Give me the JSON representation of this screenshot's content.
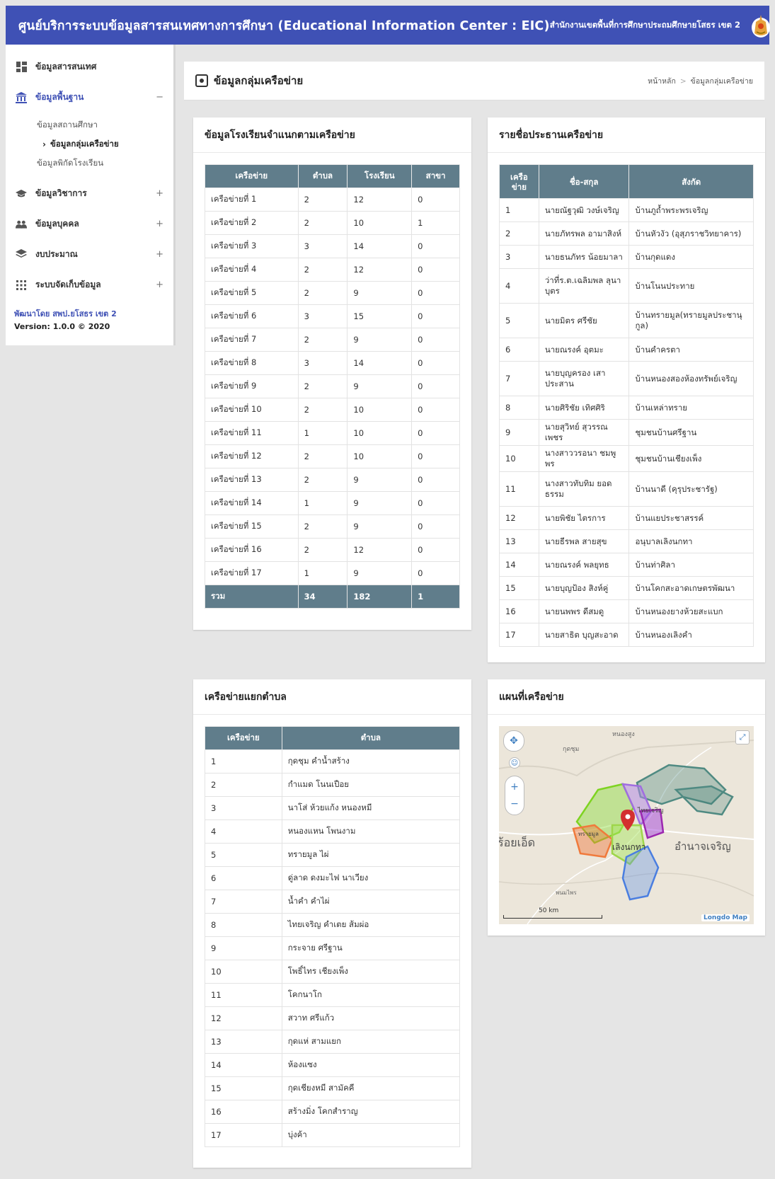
{
  "header": {
    "site_title": "ศูนย์บริการระบบข้อมูลสารสนเทศทางการศึกษา (Educational Information Center : EIC)",
    "office": "สำนักงานเขตพื้นที่การศึกษาประถมศึกษายโสธร เขต 2"
  },
  "sidebar": {
    "items": [
      {
        "label": "ข้อมูลสารสนเทศ",
        "icon": "dashboard-icon"
      },
      {
        "label": "ข้อมูลพื้นฐาน",
        "icon": "institution-icon",
        "toggle": "−"
      },
      {
        "label": "ข้อมูลวิชาการ",
        "icon": "graduation-cap-icon",
        "toggle": "+"
      },
      {
        "label": "ข้อมูลบุคคล",
        "icon": "people-icon",
        "toggle": "+"
      },
      {
        "label": "งบประมาณ",
        "icon": "layers-icon",
        "toggle": "+"
      },
      {
        "label": "ระบบจัดเก็บข้อมูล",
        "icon": "apps-grid-icon",
        "toggle": "+"
      }
    ],
    "submenu": [
      {
        "label": "ข้อมูลสถานศึกษา"
      },
      {
        "label": "ข้อมูลกลุ่มเครือข่าย"
      },
      {
        "label": "ข้อมูลพิกัดโรงเรียน"
      }
    ],
    "footer_dev": "พัฒนาโดย สพป.ยโสธร เขต 2",
    "footer_version": "Version: 1.0.0 © 2020"
  },
  "page": {
    "title": "ข้อมูลกลุ่มเครือข่าย",
    "breadcrumb_home": "หน้าหลัก",
    "breadcrumb_sep": ">",
    "breadcrumb_current": "ข้อมูลกลุ่มเครือข่าย"
  },
  "schools_card": {
    "title": "ข้อมูลโรงเรียนจำแนกตามเครือข่าย",
    "headers": [
      "เครือข่าย",
      "ตำบล",
      "โรงเรียน",
      "สาขา"
    ],
    "rows": [
      [
        "เครือข่ายที่ 1",
        "2",
        "12",
        "0"
      ],
      [
        "เครือข่ายที่ 2",
        "2",
        "10",
        "1"
      ],
      [
        "เครือข่ายที่ 3",
        "3",
        "14",
        "0"
      ],
      [
        "เครือข่ายที่ 4",
        "2",
        "12",
        "0"
      ],
      [
        "เครือข่ายที่ 5",
        "2",
        "9",
        "0"
      ],
      [
        "เครือข่ายที่ 6",
        "3",
        "15",
        "0"
      ],
      [
        "เครือข่ายที่ 7",
        "2",
        "9",
        "0"
      ],
      [
        "เครือข่ายที่ 8",
        "3",
        "14",
        "0"
      ],
      [
        "เครือข่ายที่ 9",
        "2",
        "9",
        "0"
      ],
      [
        "เครือข่ายที่ 10",
        "2",
        "10",
        "0"
      ],
      [
        "เครือข่ายที่ 11",
        "1",
        "10",
        "0"
      ],
      [
        "เครือข่ายที่ 12",
        "2",
        "10",
        "0"
      ],
      [
        "เครือข่ายที่ 13",
        "2",
        "9",
        "0"
      ],
      [
        "เครือข่ายที่ 14",
        "1",
        "9",
        "0"
      ],
      [
        "เครือข่ายที่ 15",
        "2",
        "9",
        "0"
      ],
      [
        "เครือข่ายที่ 16",
        "2",
        "12",
        "0"
      ],
      [
        "เครือข่ายที่ 17",
        "1",
        "9",
        "0"
      ]
    ],
    "total": [
      "รวม",
      "34",
      "182",
      "1"
    ]
  },
  "chairs_card": {
    "title": "รายชื่อประธานเครือข่าย",
    "headers": [
      "เครือ ข่าย",
      "ชื่อ-สกุล",
      "สังกัด"
    ],
    "rows": [
      [
        "1",
        "นายณัฐวุฒิ วงษ์เจริญ",
        "บ้านภูถ้ำพระพรเจริญ"
      ],
      [
        "2",
        "นายภัทรพล อามาสิงห์",
        "บ้านหัวงัว (อุสุภราชวิทยาคาร)"
      ],
      [
        "3",
        "นายธนภัทร น้อยมาลา",
        "บ้านกุดแดง"
      ],
      [
        "4",
        "ว่าที่ร.ต.เฉลิมพล ลุนาบุตร",
        "บ้านโนนประทาย"
      ],
      [
        "5",
        "นายมิตร ศรีชัย",
        "บ้านทรายมูล(ทรายมูลประชานุกูล)"
      ],
      [
        "6",
        "นายณรงค์ อุตมะ",
        "บ้านคำครตา"
      ],
      [
        "7",
        "นายบุญครอง เสาประสาน",
        "บ้านหนองสองห้องทรัพย์เจริญ"
      ],
      [
        "8",
        "นายศิริชัย เทิศศิริ",
        "บ้านเหล่าทราย"
      ],
      [
        "9",
        "นายสุวิทย์ สุวรรณเพชร",
        "ชุมชนบ้านศรีฐาน"
      ],
      [
        "10",
        "นางสาววรอนา ชมพูพร",
        "ชุมชนบ้านเชียงเพ็ง"
      ],
      [
        "11",
        "นางสาวทับทิม ยอดธรรม",
        "บ้านนาดี (คุรุประชารัฐ)"
      ],
      [
        "12",
        "นายพิชัย ไตรการ",
        "บ้านแยประชาสรรค์"
      ],
      [
        "13",
        "นายธีรพล สายสุข",
        "อนุบาลเลิงนกทา"
      ],
      [
        "14",
        "นายณรงค์ พลยุทธ",
        "บ้านท่าศิลา"
      ],
      [
        "15",
        "นายบุญป้อง สิงห์คู่",
        "บ้านโคกสะอาดเกษตรพัฒนา"
      ],
      [
        "16",
        "นายนพพร ดีสมดู",
        "บ้านหนองยางห้วยสะแบก"
      ],
      [
        "17",
        "นายสาธิต บุญสะอาด",
        "บ้านหนองเลิงคำ"
      ]
    ]
  },
  "tambon_card": {
    "title": "เครือข่ายแยกตำบล",
    "headers": [
      "เครือข่าย",
      "ตำบล"
    ],
    "rows": [
      [
        "1",
        "กุดชุม คำน้ำสร้าง"
      ],
      [
        "2",
        "กำแมด โนนเปือย"
      ],
      [
        "3",
        "นาโส่ ห้วยแก้ง หนองหมี"
      ],
      [
        "4",
        "หนองแหน โพนงาม"
      ],
      [
        "5",
        "ทรายมูล ไผ่"
      ],
      [
        "6",
        "ดู่ลาด ดงมะไฟ นาเวียง"
      ],
      [
        "7",
        "น้ำคำ คำไผ่"
      ],
      [
        "8",
        "ไทยเจริญ คำเตย ส้มผ่อ"
      ],
      [
        "9",
        "กระจาย ศรีฐาน"
      ],
      [
        "10",
        "โพธิ์ไทร เชียงเพ็ง"
      ],
      [
        "11",
        "โคกนาโก"
      ],
      [
        "12",
        "สวาท ศรีแก้ว"
      ],
      [
        "13",
        "กุดแห่ สามแยก"
      ],
      [
        "14",
        "ห้องแซง"
      ],
      [
        "15",
        "กุดเชียงหมี สามัคคี"
      ],
      [
        "16",
        "สร้างมิ่ง โคกสำราญ"
      ],
      [
        "17",
        "บุ่งค้า"
      ]
    ]
  },
  "map_card": {
    "title": "แผนที่เครือข่าย",
    "labels": {
      "roiet": "ร้อยเอ็ด",
      "amnat": "อำนาจเจริญ",
      "nong_sung": "หนองสูง",
      "loeng_nok_tha": "เลิงนกทา",
      "thai_charoen": "ไทยเจริญ",
      "kut_chum": "กุดชุม",
      "sai_mun": "ทรายมูล",
      "phanom_phrai": "พนมไพร",
      "scale": "50 km",
      "attribution": "Longdo Map"
    }
  }
}
